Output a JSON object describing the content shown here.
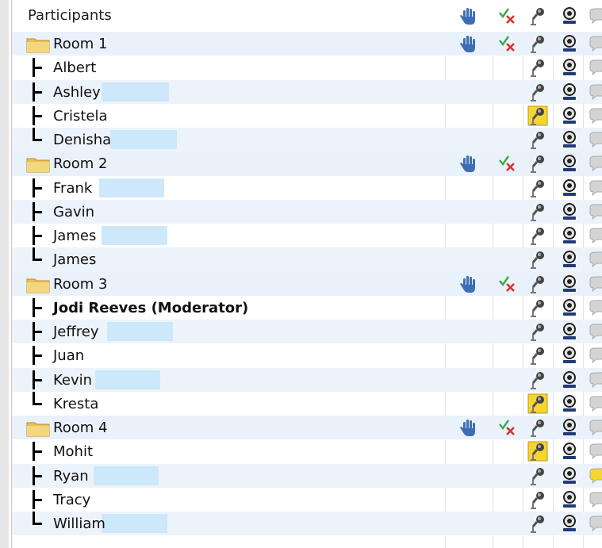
{
  "header": {
    "title": "Participants"
  },
  "header_icons": [
    "raise-hand-icon",
    "check-x-icon",
    "microphone-icon",
    "webcam-icon",
    "chat-bubble-icon"
  ],
  "rooms": [
    {
      "label": "Room 1",
      "members": [
        {
          "name": "Albert"
        },
        {
          "name": "Ashley"
        },
        {
          "name": "Cristela",
          "mic_active": true
        },
        {
          "name": "Denisha"
        }
      ]
    },
    {
      "label": "Room 2",
      "members": [
        {
          "name": "Frank"
        },
        {
          "name": "Gavin"
        },
        {
          "name": "James"
        },
        {
          "name": "James"
        }
      ]
    },
    {
      "label": "Room 3",
      "members": [
        {
          "name": "Jodi Reeves (Moderator)",
          "bold": true
        },
        {
          "name": "Jeffrey"
        },
        {
          "name": "Juan"
        },
        {
          "name": "Kevin"
        },
        {
          "name": "Kresta",
          "mic_active": true
        }
      ]
    },
    {
      "label": "Room 4",
      "members": [
        {
          "name": "Mohit",
          "mic_active": true
        },
        {
          "name": "Ryan",
          "chat_active": true
        },
        {
          "name": "Tracy"
        },
        {
          "name": "William"
        }
      ]
    }
  ],
  "colors": {
    "row_alt": "#ecf3fb",
    "highlight": "#cde8fb",
    "mic_active": "#f7d530",
    "hand": "#3e6db6",
    "check": "#39a845",
    "x_mark": "#d8332d"
  }
}
